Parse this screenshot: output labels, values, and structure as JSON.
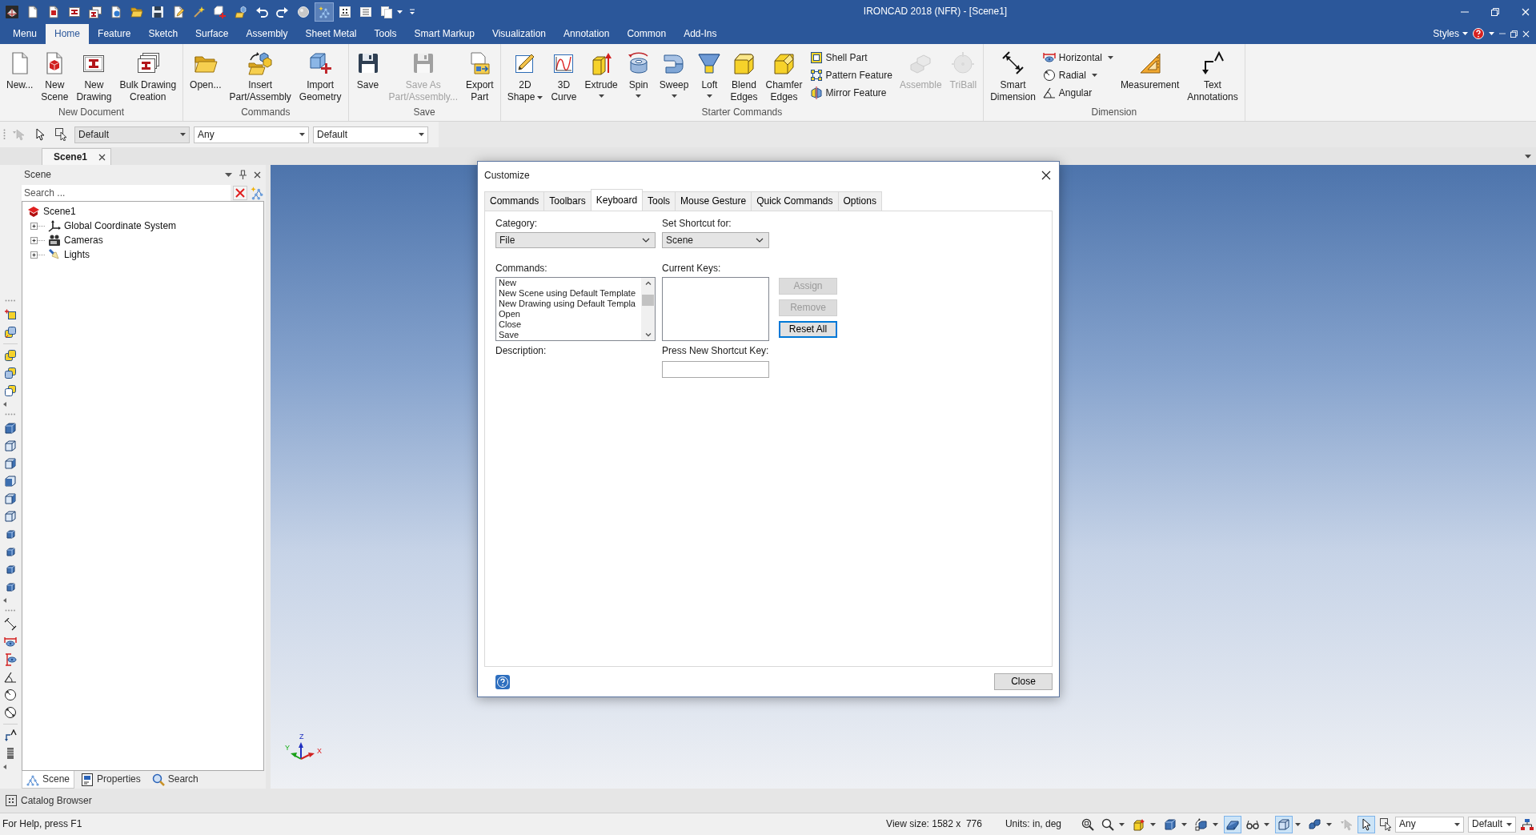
{
  "window": {
    "title": "IRONCAD 2018 (NFR) - [Scene1]"
  },
  "quick_access": [
    {
      "on": false,
      "dropdown": false
    },
    {
      "on": false,
      "dropdown": false
    },
    {
      "on": false,
      "dropdown": false
    },
    {
      "on": false,
      "dropdown": false
    },
    {
      "on": false,
      "dropdown": false
    },
    {
      "on": false,
      "dropdown": false
    },
    {
      "on": false,
      "dropdown": false
    },
    {
      "on": false,
      "dropdown": false
    },
    {
      "on": false,
      "dropdown": false
    },
    {
      "on": false,
      "dropdown": false
    },
    {
      "on": false,
      "dropdown": false
    },
    {
      "on": false,
      "dropdown": false
    },
    {
      "on": false,
      "dropdown": false
    },
    {
      "on": false,
      "dropdown": false
    },
    {
      "on": false,
      "dropdown": false
    },
    {
      "on": true,
      "dropdown": false
    },
    {
      "on": false,
      "dropdown": false
    },
    {
      "on": false,
      "dropdown": false
    },
    {
      "on": false,
      "dropdown": true
    },
    {
      "on": false,
      "dropdown": false
    }
  ],
  "ribbon_tabs": [
    {
      "label": "Menu",
      "selected": false
    },
    {
      "label": "Home",
      "selected": true
    },
    {
      "label": "Feature",
      "selected": false
    },
    {
      "label": "Sketch",
      "selected": false
    },
    {
      "label": "Surface",
      "selected": false
    },
    {
      "label": "Assembly",
      "selected": false
    },
    {
      "label": "Sheet Metal",
      "selected": false
    },
    {
      "label": "Tools",
      "selected": false
    },
    {
      "label": "Smart Markup",
      "selected": false
    },
    {
      "label": "Visualization",
      "selected": false
    },
    {
      "label": "Annotation",
      "selected": false
    },
    {
      "label": "Common",
      "selected": false
    },
    {
      "label": "Add-Ins",
      "selected": false
    }
  ],
  "ribbon_right": {
    "styles": "Styles"
  },
  "ribbon_groups": [
    {
      "title": "New Document",
      "items": [
        {
          "kind": "large",
          "label": "New...",
          "disabled": false,
          "dropdown": false
        },
        {
          "kind": "large",
          "label": "New\nScene",
          "disabled": false,
          "dropdown": false
        },
        {
          "kind": "large",
          "label": "New\nDrawing",
          "disabled": false,
          "dropdown": false
        },
        {
          "kind": "large",
          "label": "Bulk Drawing\nCreation",
          "disabled": false,
          "dropdown": false
        }
      ]
    },
    {
      "title": "Commands",
      "items": [
        {
          "kind": "large",
          "label": "Open...",
          "disabled": false,
          "dropdown": false
        },
        {
          "kind": "large",
          "label": "Insert\nPart/Assembly",
          "disabled": false,
          "dropdown": false
        },
        {
          "kind": "large",
          "label": "Import\nGeometry",
          "disabled": false,
          "dropdown": false
        }
      ]
    },
    {
      "title": "Save",
      "items": [
        {
          "kind": "large",
          "label": "Save",
          "disabled": false,
          "dropdown": false
        },
        {
          "kind": "large",
          "label": "Save As\nPart/Assembly...",
          "disabled": true,
          "dropdown": false
        },
        {
          "kind": "large",
          "label": "Export\nPart",
          "disabled": false,
          "dropdown": false
        }
      ]
    },
    {
      "title": "Starter Commands",
      "items": [
        {
          "kind": "large",
          "label": "2D\nShape",
          "disabled": false,
          "dropdown": true
        },
        {
          "kind": "large",
          "label": "3D\nCurve",
          "disabled": false,
          "dropdown": false
        },
        {
          "kind": "large",
          "label": "Extrude",
          "disabled": false,
          "dropdown": true
        },
        {
          "kind": "large",
          "label": "Spin",
          "disabled": false,
          "dropdown": true
        },
        {
          "kind": "large",
          "label": "Sweep",
          "disabled": false,
          "dropdown": true
        },
        {
          "kind": "large",
          "label": "Loft",
          "disabled": false,
          "dropdown": true
        },
        {
          "kind": "large",
          "label": "Blend\nEdges",
          "disabled": false,
          "dropdown": false
        },
        {
          "kind": "large",
          "label": "Chamfer\nEdges",
          "disabled": false,
          "dropdown": false
        },
        {
          "kind": "small",
          "label": "Shell Part",
          "disabled": false,
          "dropdown": false
        },
        {
          "kind": "small",
          "label": "Pattern Feature",
          "disabled": false,
          "dropdown": false
        },
        {
          "kind": "small",
          "label": "Mirror Feature",
          "disabled": false,
          "dropdown": false
        },
        {
          "kind": "large",
          "label": "Assemble",
          "disabled": true,
          "dropdown": false
        },
        {
          "kind": "large",
          "label": "TriBall",
          "disabled": true,
          "dropdown": false
        }
      ]
    },
    {
      "title": "Dimension",
      "items": [
        {
          "kind": "large",
          "label": "Smart\nDimension",
          "disabled": false,
          "dropdown": false
        },
        {
          "kind": "small",
          "label": "Horizontal",
          "disabled": false,
          "dropdown": true
        },
        {
          "kind": "small",
          "label": "Radial",
          "disabled": false,
          "dropdown": true
        },
        {
          "kind": "small",
          "label": "Angular",
          "disabled": false,
          "dropdown": false
        },
        {
          "kind": "large",
          "label": "Measurement",
          "disabled": false,
          "dropdown": false
        },
        {
          "kind": "large",
          "label": "Text\nAnnotations",
          "disabled": false,
          "dropdown": false
        }
      ]
    }
  ],
  "selection_toolbar": {
    "tools": [
      {
        "disabled": true
      },
      {
        "disabled": false
      },
      {
        "disabled": false
      }
    ],
    "combos": [
      {
        "value": "Default",
        "disabled": true
      },
      {
        "value": "Any",
        "disabled": false
      },
      {
        "value": "Default",
        "disabled": false
      }
    ]
  },
  "document_tabs": [
    {
      "label": "Scene1",
      "selected": true
    }
  ],
  "scene_panel": {
    "title": "Scene",
    "search": {
      "placeholder": "Search ..."
    },
    "tree": [
      {
        "label": "Scene1",
        "children": [
          {
            "label": "Global Coordinate System",
            "expanded": false
          },
          {
            "label": "Cameras",
            "expanded": false
          },
          {
            "label": "Lights",
            "expanded": false
          }
        ]
      }
    ],
    "tabs": [
      {
        "label": "Scene",
        "selected": true
      },
      {
        "label": "Properties",
        "selected": false
      },
      {
        "label": "Search",
        "selected": false
      }
    ]
  },
  "catalog_browser": {
    "label": "Catalog Browser"
  },
  "viewport": {
    "triad": {
      "up_label": "Z",
      "left_label": "Y",
      "right_label": "X"
    }
  },
  "dialog": {
    "title": "Customize",
    "tabs": [
      {
        "label": "Commands",
        "selected": false
      },
      {
        "label": "Toolbars",
        "selected": false
      },
      {
        "label": "Keyboard",
        "selected": true
      },
      {
        "label": "Tools",
        "selected": false
      },
      {
        "label": "Mouse Gesture",
        "selected": false
      },
      {
        "label": "Quick Commands",
        "selected": false
      },
      {
        "label": "Options",
        "selected": false
      }
    ],
    "category": {
      "label": "Category:",
      "value": "File"
    },
    "shortcut_for": {
      "label": "Set Shortcut for:",
      "value": "Scene"
    },
    "commands": {
      "label": "Commands:",
      "items": [
        {
          "label": "New",
          "selected": false
        },
        {
          "label": "New Scene using Default Template",
          "selected": false
        },
        {
          "label": "New Drawing using Default Templa",
          "selected": false
        },
        {
          "label": "Open",
          "selected": false
        },
        {
          "label": "Close",
          "selected": false
        },
        {
          "label": "Save",
          "selected": false
        }
      ]
    },
    "current_keys": {
      "label": "Current Keys:"
    },
    "buttons": [
      {
        "label": "Assign",
        "disabled": true,
        "focused": false
      },
      {
        "label": "Remove",
        "disabled": true,
        "focused": false
      },
      {
        "label": "Reset All",
        "disabled": false,
        "focused": true
      }
    ],
    "description": {
      "label": "Description:"
    },
    "new_shortcut": {
      "label": "Press New Shortcut Key:"
    },
    "close_button": {
      "label": "Close"
    }
  },
  "status_bar": {
    "help": "For Help, press F1",
    "view_size": "View size: 1582 x  776",
    "units": "Units: in, deg",
    "view_tools": [
      {
        "on": false,
        "dropdown": false,
        "disabled": false
      },
      {
        "on": false,
        "dropdown": true,
        "disabled": false
      },
      {
        "on": false,
        "dropdown": true,
        "disabled": false
      },
      {
        "on": false,
        "dropdown": true,
        "disabled": false
      },
      {
        "on": false,
        "dropdown": true,
        "disabled": false
      },
      {
        "on": true,
        "dropdown": false,
        "disabled": false
      },
      {
        "on": false,
        "dropdown": true,
        "disabled": false
      },
      {
        "on": true,
        "dropdown": true,
        "disabled": false
      },
      {
        "on": false,
        "dropdown": true,
        "disabled": false
      },
      {
        "on": false,
        "dropdown": false,
        "disabled": true
      },
      {
        "on": true,
        "dropdown": false,
        "disabled": false
      },
      {
        "on": false,
        "dropdown": false,
        "disabled": false
      }
    ],
    "combos": [
      {
        "value": "Any"
      },
      {
        "value": "Default"
      }
    ]
  }
}
